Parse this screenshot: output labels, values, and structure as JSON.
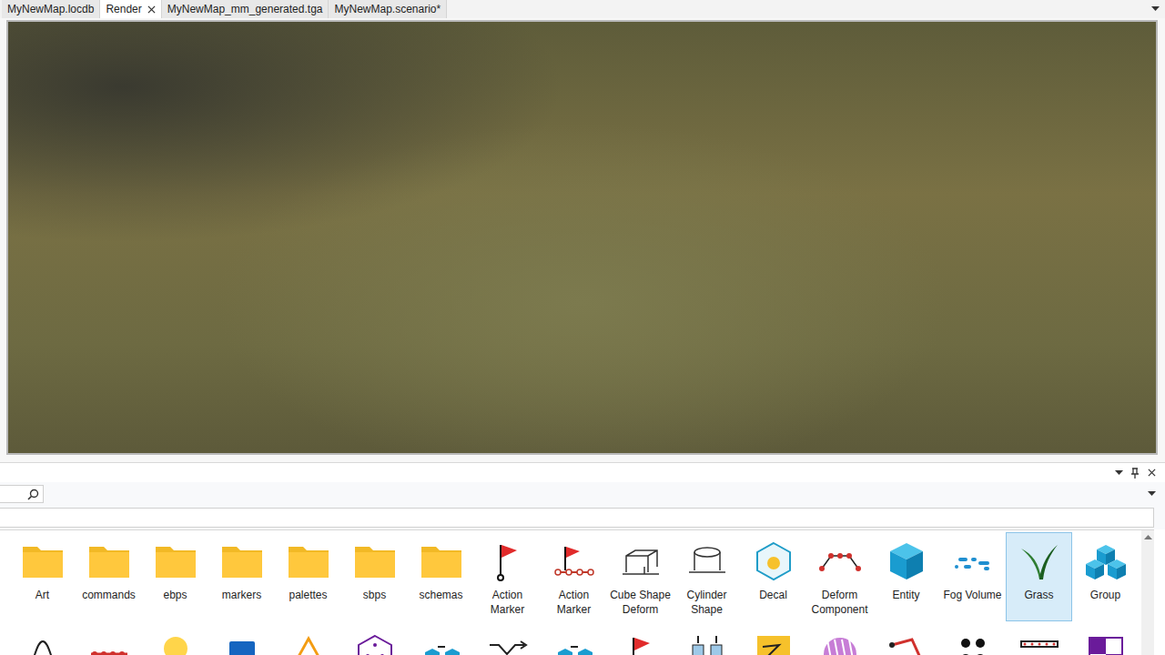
{
  "window": {
    "title": "Render"
  },
  "tabs": [
    {
      "label": "MyNewMap.locdb",
      "selected": false,
      "closable": false
    },
    {
      "label": "Render",
      "selected": true,
      "closable": true
    },
    {
      "label": "MyNewMap_mm_generated.tga",
      "selected": false,
      "closable": false
    },
    {
      "label": "MyNewMap.scenario*",
      "selected": false,
      "closable": false
    }
  ],
  "search": {
    "value": ""
  },
  "filter": {
    "value": ""
  },
  "assets": [
    {
      "label": "Art",
      "kind": "folder",
      "selected": false
    },
    {
      "label": "commands",
      "kind": "folder",
      "selected": false
    },
    {
      "label": "ebps",
      "kind": "folder",
      "selected": false
    },
    {
      "label": "markers",
      "kind": "folder",
      "selected": false
    },
    {
      "label": "palettes",
      "kind": "folder",
      "selected": false
    },
    {
      "label": "sbps",
      "kind": "folder",
      "selected": false
    },
    {
      "label": "schemas",
      "kind": "folder",
      "selected": false
    },
    {
      "label": "Action Marker",
      "kind": "flag",
      "selected": false
    },
    {
      "label": "Action Marker",
      "kind": "flag-path",
      "selected": false
    },
    {
      "label": "Cube Shape Deform",
      "kind": "cube-outline",
      "selected": false
    },
    {
      "label": "Cylinder Shape",
      "kind": "cylinder",
      "selected": false
    },
    {
      "label": "Decal",
      "kind": "decal",
      "selected": false
    },
    {
      "label": "Deform Component",
      "kind": "deform",
      "selected": false
    },
    {
      "label": "Entity",
      "kind": "entity",
      "selected": false
    },
    {
      "label": "Fog Volume",
      "kind": "fog",
      "selected": false
    },
    {
      "label": "Grass",
      "kind": "grass",
      "selected": true
    },
    {
      "label": "Group",
      "kind": "group",
      "selected": false
    }
  ],
  "assets_next_row": [
    {
      "kind": "curve",
      "selected": false
    },
    {
      "kind": "dotted-path",
      "selected": false
    },
    {
      "kind": "bulb",
      "selected": false
    },
    {
      "kind": "square",
      "selected": false
    },
    {
      "kind": "warning",
      "selected": false
    },
    {
      "kind": "dice",
      "selected": false
    },
    {
      "kind": "cubes-arrow",
      "selected": false
    },
    {
      "kind": "shuffle",
      "selected": false
    },
    {
      "kind": "cubes-eq",
      "selected": false
    },
    {
      "kind": "flag",
      "selected": false
    },
    {
      "kind": "bars",
      "selected": false
    },
    {
      "kind": "note",
      "selected": false
    },
    {
      "kind": "pattern",
      "selected": false
    },
    {
      "kind": "nodes",
      "selected": false
    },
    {
      "kind": "people",
      "selected": false
    },
    {
      "kind": "fence",
      "selected": false
    },
    {
      "kind": "checker",
      "selected": false
    }
  ]
}
